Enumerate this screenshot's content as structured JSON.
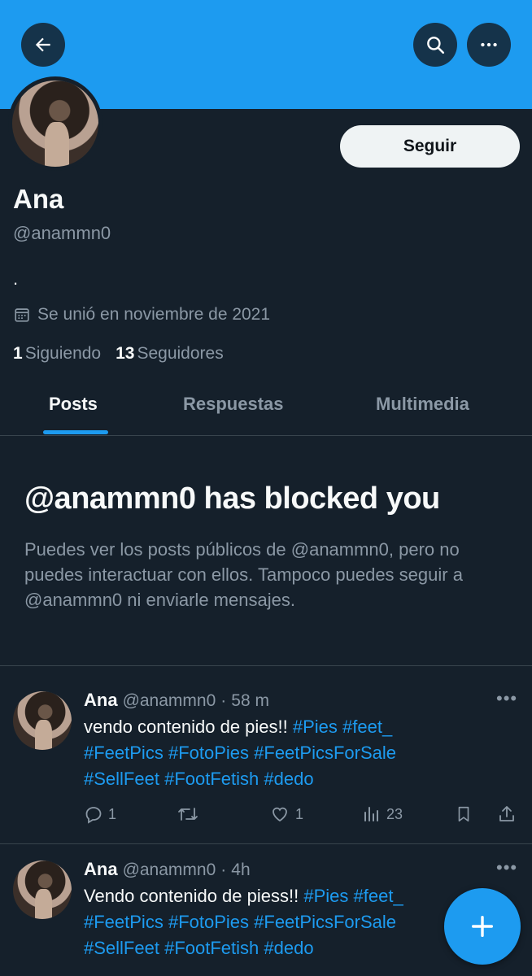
{
  "header": {
    "back_icon": "arrow-left-icon",
    "search_icon": "search-icon",
    "more_icon": "more-icon"
  },
  "profile": {
    "follow_label": "Seguir",
    "name": "Ana",
    "handle": "@anammn0",
    "bio": ".",
    "joined": "Se unió en noviembre de 2021",
    "following_count": "1",
    "following_label": "Siguiendo",
    "followers_count": "13",
    "followers_label": "Seguidores"
  },
  "tabs": [
    {
      "label": "Posts",
      "active": true
    },
    {
      "label": "Respuestas",
      "active": false
    },
    {
      "label": "Multimedia",
      "active": false
    }
  ],
  "blocked": {
    "title": "@anammn0 has blocked you",
    "text": "Puedes ver los posts públicos de @anammn0, pero no puedes interactuar con ellos. Tampoco puedes seguir a @anammn0 ni enviarle mensajes."
  },
  "posts": [
    {
      "name": "Ana",
      "handle": "@anammn0",
      "sep": "·",
      "time": "58 m",
      "text": "vendo contenido de pies!!",
      "tags": [
        "#Pies",
        "#feet_",
        "#FeetPics",
        "#FotoPies",
        "#FeetPicsForSale",
        "#SellFeet",
        "#FootFetish",
        "#dedo"
      ],
      "replies": "1",
      "likes": "1",
      "views": "23"
    },
    {
      "name": "Ana",
      "handle": "@anammn0",
      "sep": "·",
      "time": "4h",
      "text": "Vendo contenido de piess!!",
      "tags": [
        "#Pies",
        "#feet_",
        "#FeetPics",
        "#FotoPies",
        "#FeetPicsForSale",
        "#SellFeet",
        "#FootFetish",
        "#dedo"
      ]
    }
  ],
  "fab": {
    "icon": "plus-icon"
  },
  "colors": {
    "accent": "#1d9bf0",
    "background": "#15202b",
    "muted": "#8b98a5"
  }
}
